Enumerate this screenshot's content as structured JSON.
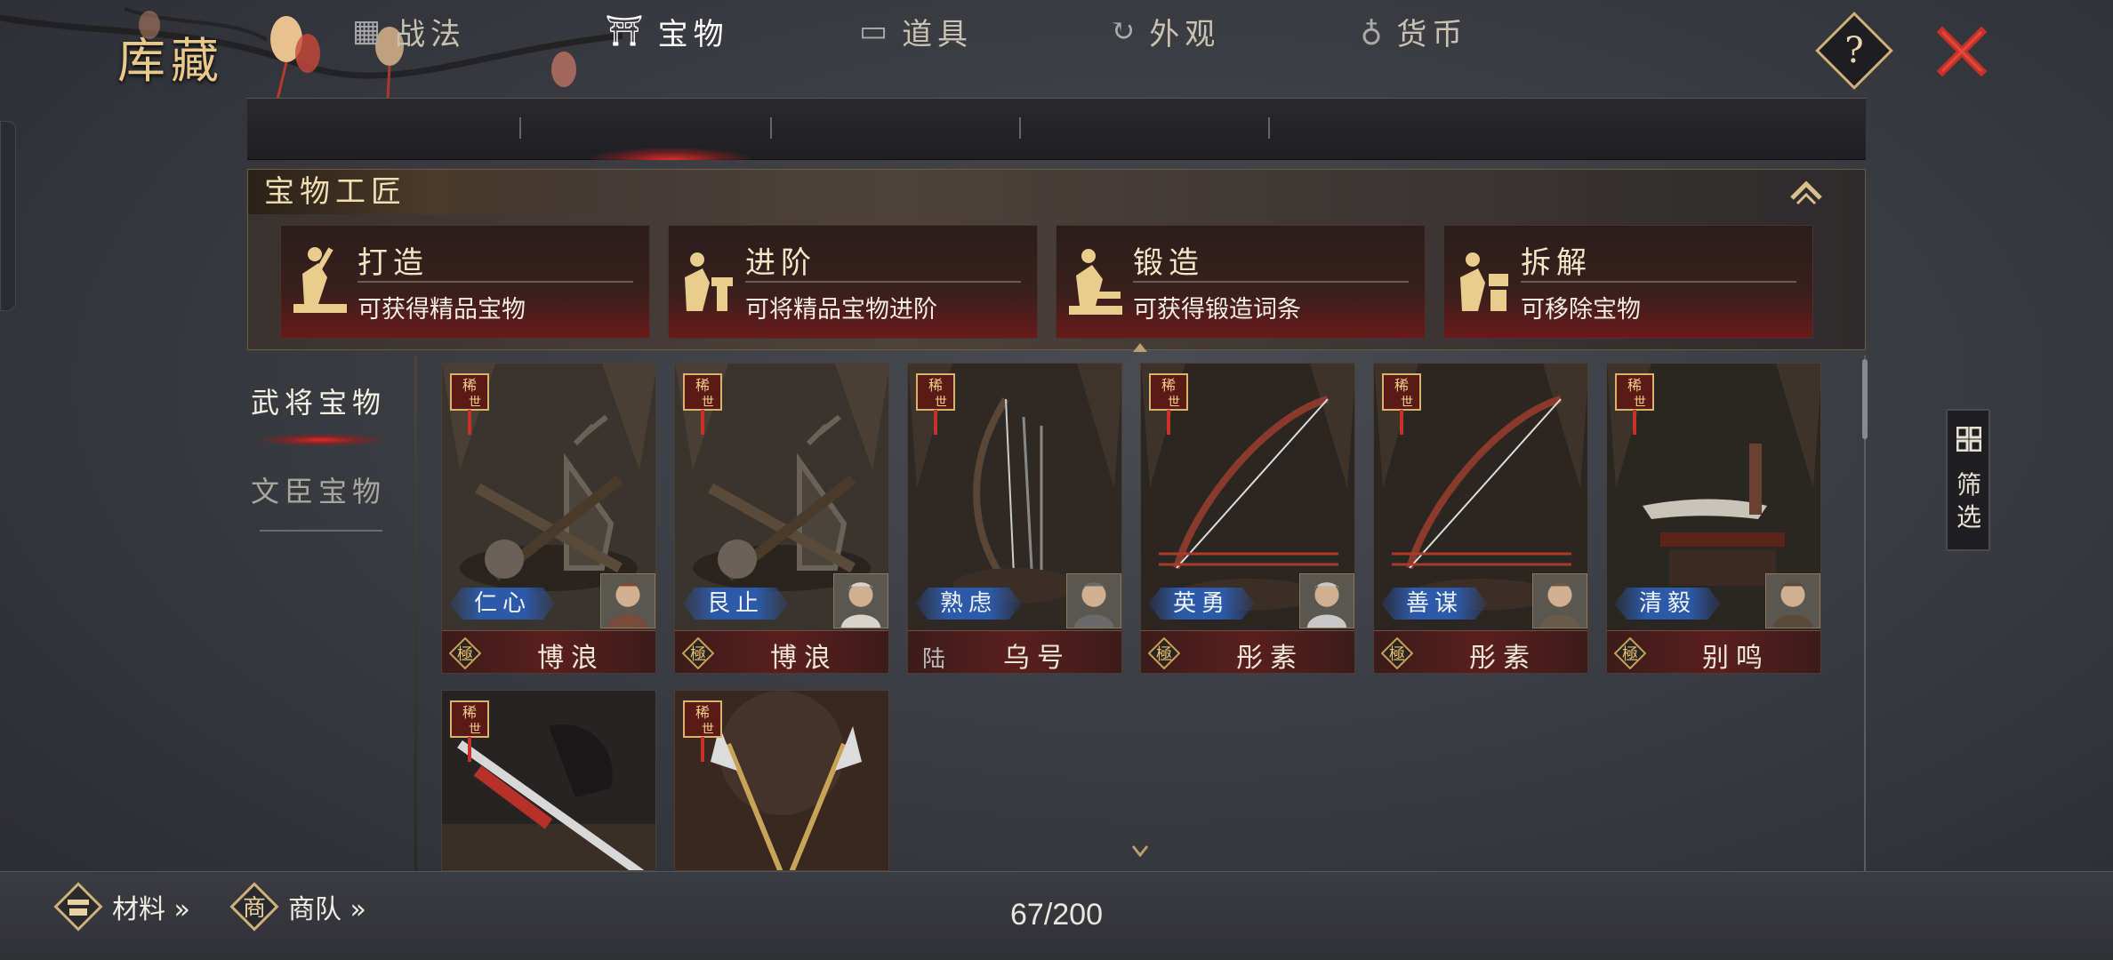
{
  "header": {
    "title": "库藏",
    "help_icon": "question-diamond-icon",
    "close_icon": "close-x-icon"
  },
  "tabs": [
    {
      "label": "战法",
      "icon": "scroll-bundle-icon",
      "active": false
    },
    {
      "label": "宝物",
      "icon": "treasure-stand-icon",
      "active": true
    },
    {
      "label": "道具",
      "icon": "chest-icon",
      "active": false
    },
    {
      "label": "外观",
      "icon": "swirl-icon",
      "active": false
    },
    {
      "label": "货币",
      "icon": "money-bag-icon",
      "active": false
    }
  ],
  "artisan": {
    "title": "宝物工匠",
    "cards": [
      {
        "name": "打造",
        "desc": "可获得精品宝物",
        "icon": "smith-hammer-icon"
      },
      {
        "name": "进阶",
        "desc": "可将精品宝物进阶",
        "icon": "smith-anvil-icon"
      },
      {
        "name": "锻造",
        "desc": "可获得锻造词条",
        "icon": "smith-forge-icon"
      },
      {
        "name": "拆解",
        "desc": "可移除宝物",
        "icon": "smith-dismantle-icon"
      }
    ]
  },
  "categories": [
    {
      "label": "武将宝物",
      "active": true
    },
    {
      "label": "文臣宝物",
      "active": false
    }
  ],
  "treasures": [
    {
      "badge": "稀世",
      "trait": "仁心",
      "grade": "極",
      "owner": "博浪",
      "art": "mace-deer-statue"
    },
    {
      "badge": "稀世",
      "trait": "艮止",
      "grade": "極",
      "owner": "博浪",
      "art": "mace-deer-statue"
    },
    {
      "badge": "稀世",
      "trait": "熟虑",
      "grade": "陆",
      "owner": "乌号",
      "art": "bow-arrows-stand"
    },
    {
      "badge": "稀世",
      "trait": "英勇",
      "grade": "極",
      "owner": "彤素",
      "art": "red-bow"
    },
    {
      "badge": "稀世",
      "trait": "善谋",
      "grade": "極",
      "owner": "彤素",
      "art": "red-bow"
    },
    {
      "badge": "稀世",
      "trait": "清毅",
      "grade": "極",
      "owner": "别鸣",
      "art": "dagger-stand"
    },
    {
      "badge": "稀世",
      "trait": "",
      "grade": "",
      "owner": "",
      "art": "sword-horse"
    },
    {
      "badge": "稀世",
      "trait": "",
      "grade": "",
      "owner": "",
      "art": "crossed-halberds-dragon"
    }
  ],
  "filter": {
    "label": "筛选",
    "icon": "grid-filter-icon"
  },
  "bottom": {
    "materials_label": "材料 »",
    "caravan_label": "商队 »",
    "caravan_icon_char": "商",
    "count": "67/200"
  },
  "colors": {
    "accent_gold": "#e9c98b",
    "active_red": "#e0302a",
    "trait_blue": "#2c5aa8",
    "close_red": "#c8302a"
  }
}
